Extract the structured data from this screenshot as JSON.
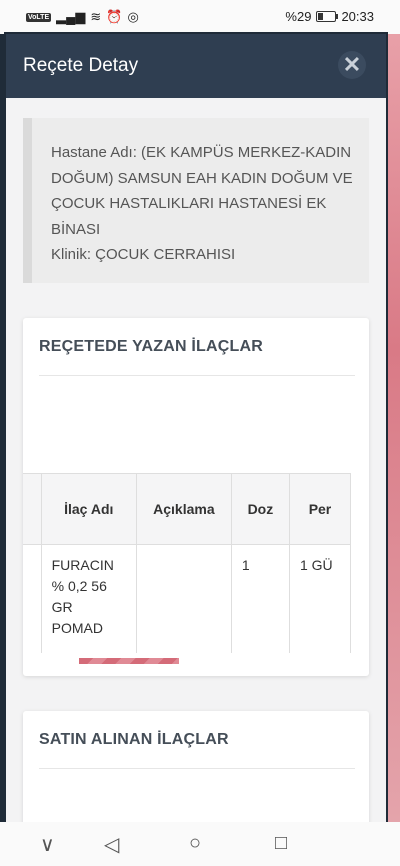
{
  "status": {
    "volte": "VoLTE",
    "battery": "%29",
    "time": "20:33"
  },
  "modal": {
    "title": "Reçete Detay",
    "close": "✕"
  },
  "info": {
    "hospital": "Hastane Adı: (EK KAMPÜS MERKEZ-KADIN DOĞUM) SAMSUN EAH KADIN DOĞUM VE ÇOCUK HASTALIKLARI HASTANESİ EK BİNASI",
    "clinic": "Klinik: ÇOCUK CERRAHISI"
  },
  "prescribed": {
    "title": "REÇETEDE YAZAN İLAÇLAR",
    "columns": [
      "",
      "İlaç Adı",
      "Açıklama",
      "Doz",
      "Per"
    ],
    "rows": [
      [
        "",
        "FURACIN % 0,2 56 GR POMAD",
        "",
        "1",
        "1 GÜ"
      ]
    ]
  },
  "purchased": {
    "title": "SATIN ALINAN İLAÇLAR"
  },
  "nav": {
    "down": "∨",
    "back": "◁",
    "home": "○",
    "recent": "□"
  }
}
